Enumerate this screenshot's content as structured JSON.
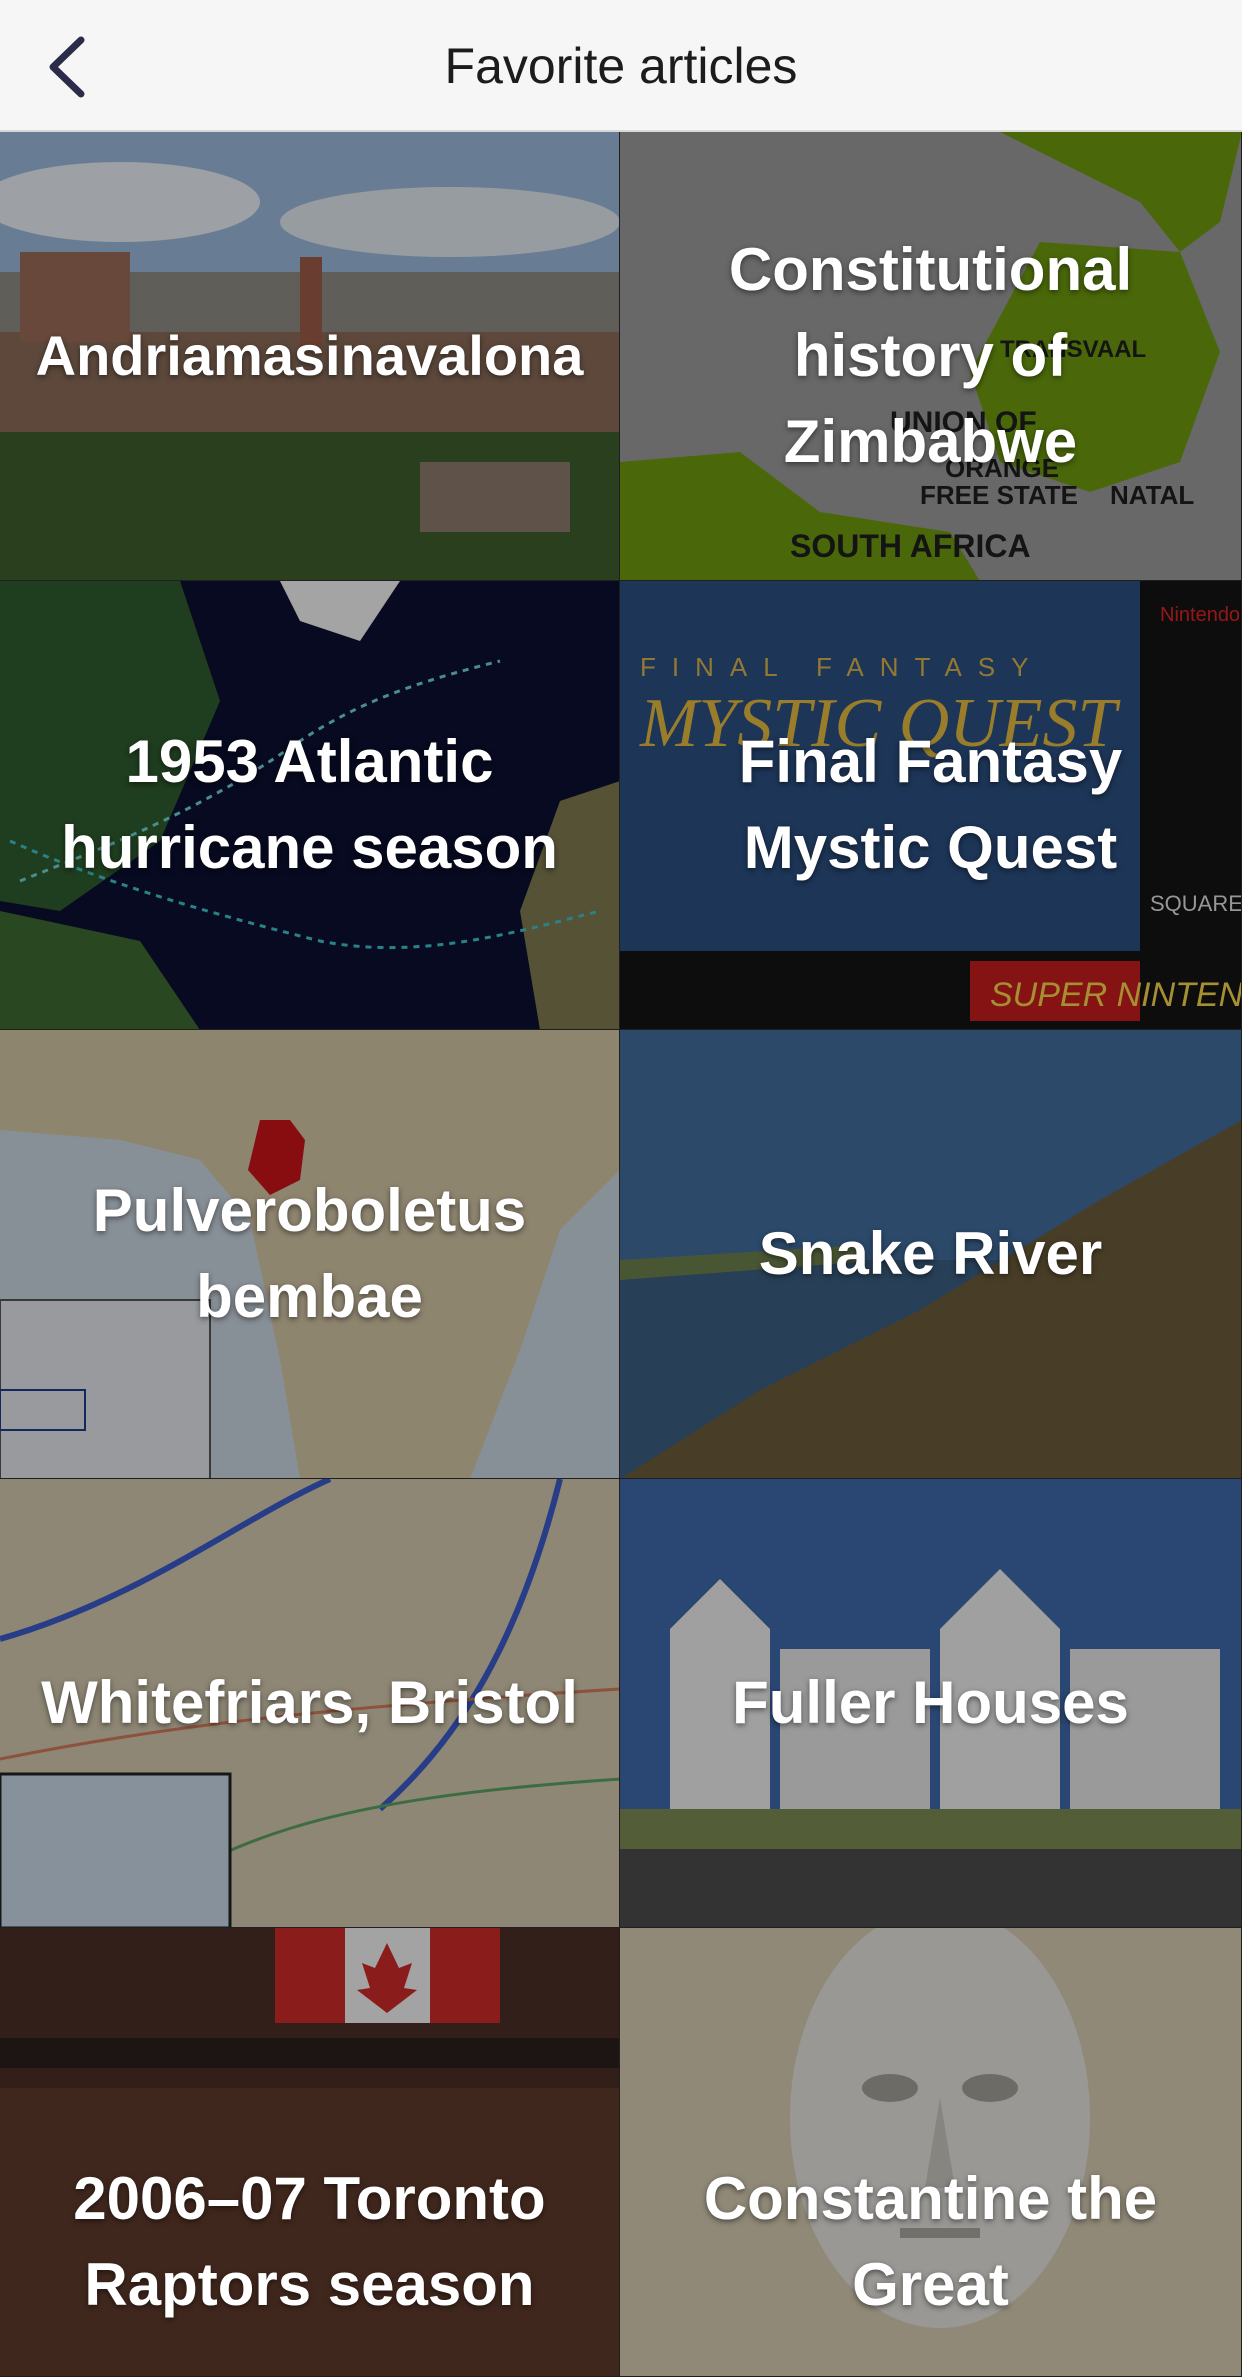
{
  "header": {
    "title": "Favorite articles",
    "back_icon": "chevron-left-icon"
  },
  "articles": [
    {
      "title": "Andriamasinavalona"
    },
    {
      "title": "Constitutional history of Zimbabwe"
    },
    {
      "title": "1953 Atlantic hurricane season"
    },
    {
      "title": "Final Fantasy Mystic Quest"
    },
    {
      "title": "Pulveroboletus bembae"
    },
    {
      "title": "Snake River"
    },
    {
      "title": "Whitefriars, Bristol"
    },
    {
      "title": "Fuller Houses"
    },
    {
      "title": "2006–07 Toronto Raptors season"
    },
    {
      "title": "Constantine the Great"
    }
  ],
  "image_labels": {
    "zimbabwe_map": [
      "TRANSVAAL",
      "UNION OF",
      "ORANGE",
      "FREE STATE",
      "NATAL",
      "SOUTH AFRICA"
    ],
    "game_box": [
      "FINAL FANTASY",
      "MYSTIC QUEST",
      "Nintendo",
      "SQUARE SOFT",
      "SUPER NINTENDO"
    ]
  },
  "colors": {
    "header_bg": "#f6f6f6",
    "header_text": "#1c1c1c",
    "tile_text": "#ffffff"
  }
}
